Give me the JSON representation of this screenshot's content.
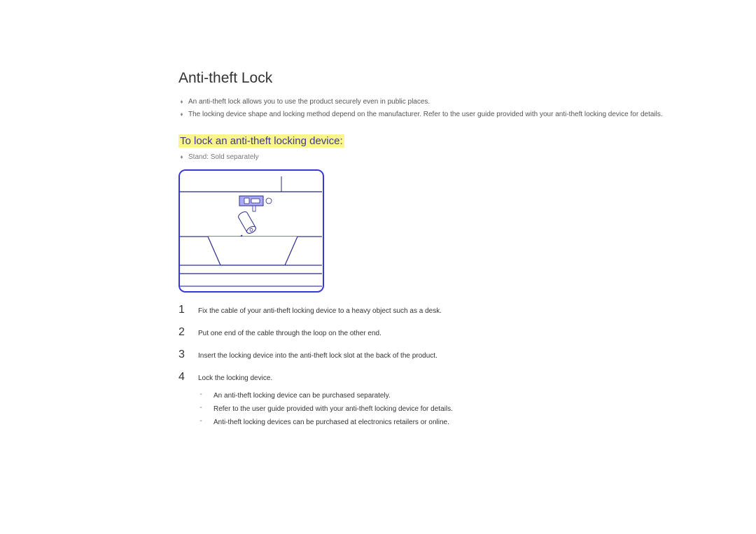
{
  "title": "Anti-theft Lock",
  "intro": [
    "An anti-theft lock allows you to use the product securely even in public places.",
    "The locking device shape and locking method depend on the manufacturer. Refer to the user guide provided with your anti-theft locking device for details."
  ],
  "section_heading": "To lock an anti-theft locking device:",
  "stand_note": "Stand: Sold separately",
  "steps": [
    {
      "num": "1",
      "text": "Fix the cable of your anti-theft locking device to a heavy object such as a desk."
    },
    {
      "num": "2",
      "text": "Put one end of the cable through the loop on the other end."
    },
    {
      "num": "3",
      "text": "Insert the locking device into the anti-theft lock slot at the back of the product."
    },
    {
      "num": "4",
      "text": "Lock the locking device."
    }
  ],
  "sub_notes": [
    "An anti-theft locking device can be purchased separately.",
    "Refer to the user guide provided with your anti-theft locking device for details.",
    "Anti-theft locking devices can be purchased at electronics retailers or online."
  ]
}
